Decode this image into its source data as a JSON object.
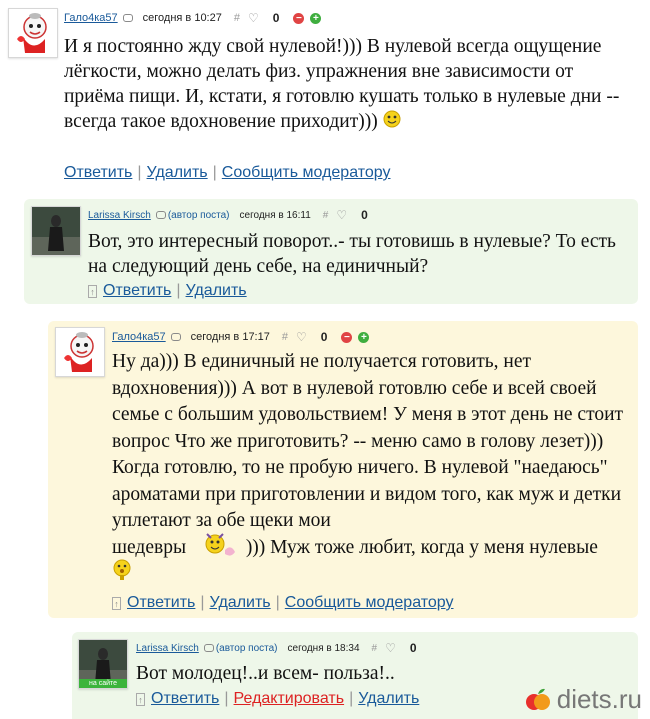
{
  "comments": [
    {
      "author": "Гало4ка57",
      "author_tag": "",
      "time": "сегодня в 10:27",
      "score": "0",
      "text": "И я постоянно жду свой нулевой!))) В нулевой всегда ощущение лёгкости, можно делать физ. упражнения вне зависимости от приёма пищи. И, кстати, я готовлю кушать только в нулевые дни -- всегда такое вдохновение приходит)))",
      "actions": [
        "Ответить",
        "Удалить",
        "Сообщить модератору"
      ]
    },
    {
      "author": "Larissa Kirsch",
      "author_tag": "(автор поста)",
      "time": "сегодня в 16:11",
      "score": "0",
      "text": "Вот, это интересный поворот..- ты готовишь в нулевые? То есть на следующий день себе, на единичный?",
      "actions": [
        "Ответить",
        "Удалить"
      ]
    },
    {
      "author": "Гало4ка57",
      "author_tag": "",
      "time": "сегодня в 17:17",
      "score": "0",
      "text": "Ну да))) В единичный не получается готовить, нет вдохновения))) А вот в нулевой готовлю себе и всей своей семье с большим удовольствием! У меня в этот день не стоит вопрос Что же приготовить? -- меню само в голову лезет))) Когда готовлю, то не пробую ничего. В нулевой \"наедаюсь\" ароматами при приготовлении и видом того, как муж и детки уплетают за обе щеки мои",
      "text_tail_a": "шедевры",
      "text_tail_b": "))) Муж тоже любит, когда у меня нулевые",
      "actions": [
        "Ответить",
        "Удалить",
        "Сообщить модератору"
      ]
    },
    {
      "author": "Larissa Kirsch",
      "author_tag": "(автор поста)",
      "time": "сегодня в 18:34",
      "score": "0",
      "online": "на сайте",
      "text": "Вот молодец!..и всем- польза!..",
      "actions": [
        "Ответить",
        "Редактировать",
        "Удалить"
      ]
    }
  ],
  "icons": {
    "hash": "#",
    "heart": "♡",
    "minus": "−",
    "plus": "+",
    "reply_up": "↑"
  },
  "watermark": "diets.ru",
  "colors": {
    "link": "#1a5a9a",
    "bg_green": "#eef7e9",
    "bg_yellow": "#fdf7dc",
    "edit_red": "#dd2222"
  }
}
